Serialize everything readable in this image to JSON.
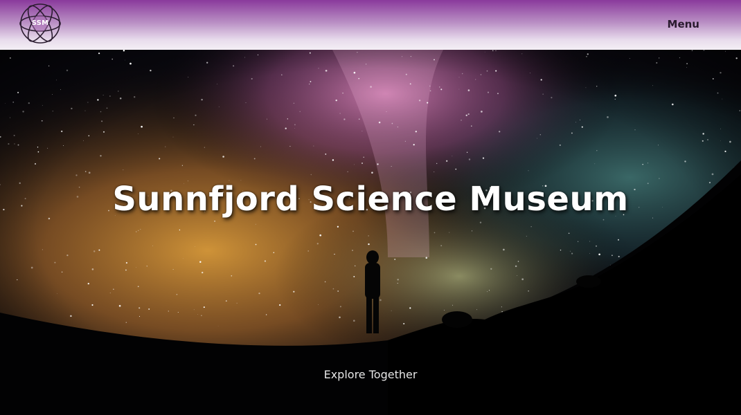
{
  "header": {
    "logo_text": "SSM",
    "menu_label": "Menu"
  },
  "hero": {
    "title": "Sunnfjord Science Museum",
    "tagline": "Explore Together"
  },
  "colors": {
    "header_top": "#8a3a9c",
    "header_bottom": "#f4eff5",
    "text_light": "#ffffff"
  },
  "icons": {
    "logo": "atom-orbit-icon"
  }
}
